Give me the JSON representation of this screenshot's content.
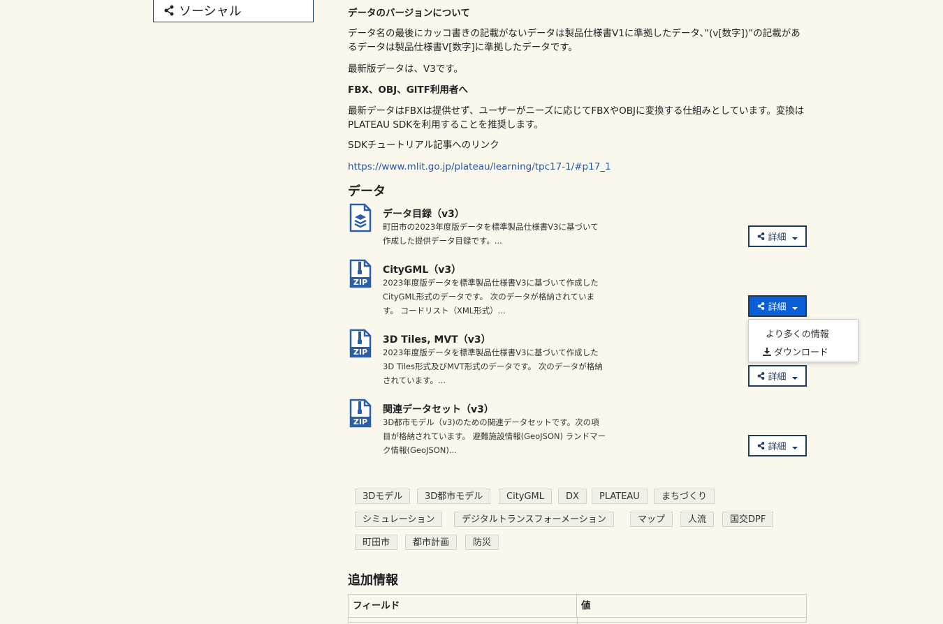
{
  "sidebar": {
    "social_label": "ソーシャル"
  },
  "intro": {
    "version_heading": "データのバージョンについて",
    "version_text": "データ名の最後にカッコ書きの記載がないデータは製品仕様書V1に準拠したデータ、”(v[数字])”の記載があるデータは製品仕様書V[数字]に準拠したデータです。",
    "latest_text": "最新版データは、V3です。",
    "fbx_heading": "FBX、OBJ、GlTF利用者へ",
    "fbx_text": "最新データはFBXは提供せず、ユーザーがニーズに応じてFBXやOBJに変換する仕組みとしています。変換はPLATEAU SDKを利用することを推奨します。",
    "sdk_text": "SDKチュートリアル記事へのリンク",
    "sdk_link": "https://www.mlit.go.jp/plateau/learning/tpc17-1/#p17_1"
  },
  "data_section": {
    "heading": "データ",
    "items": [
      {
        "title": "データ目録（v3）",
        "desc": "町田市の2023年度版データを標準製品仕様書V3に基づいて作成した提供データ目録です。...",
        "icon": "layers-file-icon",
        "button": "詳細"
      },
      {
        "title": "CityGML（v3）",
        "desc": "2023年度版データを標準製品仕様書V3に基づいて作成したCityGML形式のデータです。 次のデータが格納されています。 コードリスト（XML形式）...",
        "icon": "zip-file-icon",
        "button": "詳細"
      },
      {
        "title": "3D Tiles, MVT（v3）",
        "desc": "2023年度版データを標準製品仕様書V3に基づいて作成した3D Tiles形式及びMVT形式のデータです。 次のデータが格納されています。...",
        "icon": "zip-file-icon",
        "button": "詳細"
      },
      {
        "title": "関連データセット（v3）",
        "desc": "3D都市モデル（v3)のための関連データセットです。次の項目が格納されています。 避難施設情報(GeoJSON) ランドマーク情報(GeoJSON)...",
        "icon": "zip-file-icon",
        "button": "詳細"
      }
    ],
    "zip_label": "ZIP",
    "dropdown": {
      "more_info": "より多くの情報",
      "download": "ダウンロード"
    }
  },
  "tags": [
    "3Dモデル",
    "3D都市モデル",
    "CityGML",
    "DX",
    "PLATEAU",
    "まちづくり",
    "シミュレーション",
    "デジタルトランスフォーメーション",
    "マップ",
    "人流",
    "国交DPF",
    "町田市",
    "都市計画",
    "防災"
  ],
  "additional": {
    "heading": "追加情報",
    "col_field": "フィールド",
    "col_value": "値"
  },
  "colors": {
    "accent": "#0a5fd8",
    "border": "#1f3a5f",
    "link": "#2a55a8",
    "icon_blue": "#2a5fa8"
  }
}
